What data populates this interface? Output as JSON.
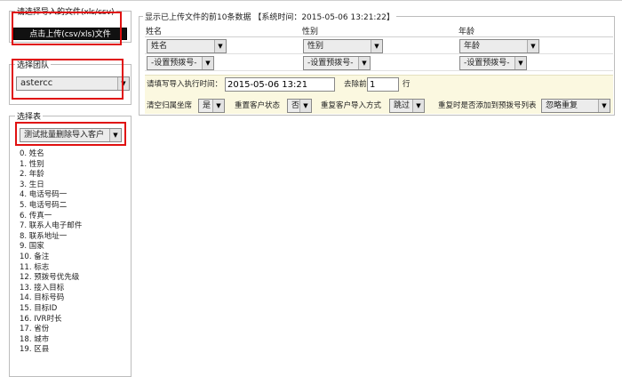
{
  "upload": {
    "legend": "请选择导入的文件(xls/csv)",
    "button_label": "点击上传(csv/xls)文件"
  },
  "team": {
    "legend": "选择团队",
    "selected": "astercc"
  },
  "table": {
    "legend": "选择表",
    "selected": "测试批量删除导入客户",
    "fields": [
      "0. 姓名",
      "1. 性别",
      "2. 年龄",
      "3. 生日",
      "4. 电话号码一",
      "5. 电话号码二",
      "6. 传真一",
      "7. 联系人电子邮件",
      "8. 联系地址一",
      "9. 国家",
      "10. 备注",
      "11. 标志",
      "12. 预拨号优先级",
      "13. 接入目标",
      "14. 目标号码",
      "15. 目标ID",
      "16. IVR时长",
      "17. 省份",
      "18. 城市",
      "19. 区县"
    ]
  },
  "preview": {
    "legend": "显示已上传文件的前10条数据 【系统时间：2015-05-06 13:21:22】",
    "columns": [
      {
        "header": "姓名",
        "field_select": "姓名",
        "dial_select": "-设置预拨号-"
      },
      {
        "header": "性别",
        "field_select": "性别",
        "dial_select": "-设置预拨号-"
      },
      {
        "header": "年龄",
        "field_select": "年龄",
        "dial_select": "-设置预拨号-"
      }
    ]
  },
  "options": {
    "time_label": "请填写导入执行时间：",
    "time_value": "2015-05-06 13:21",
    "drop_prefix": "去除前",
    "drop_value": "1",
    "drop_suffix": "行",
    "clear_label": "清空归属坐席",
    "clear_value": "是",
    "reset_label": "重置客户状态",
    "reset_value": "否",
    "dup_label": "重复客户导入方式",
    "dup_value": "跳过",
    "dup_dial_label": "重复时是否添加到预拨号列表",
    "dup_dial_value": "忽略重复"
  },
  "icons": {
    "select_arrow": "chevron-down-icon"
  },
  "colors": {
    "highlight": "#e01010",
    "upload_button_bg": "#111111",
    "options_bg": "#fbf8e0"
  }
}
